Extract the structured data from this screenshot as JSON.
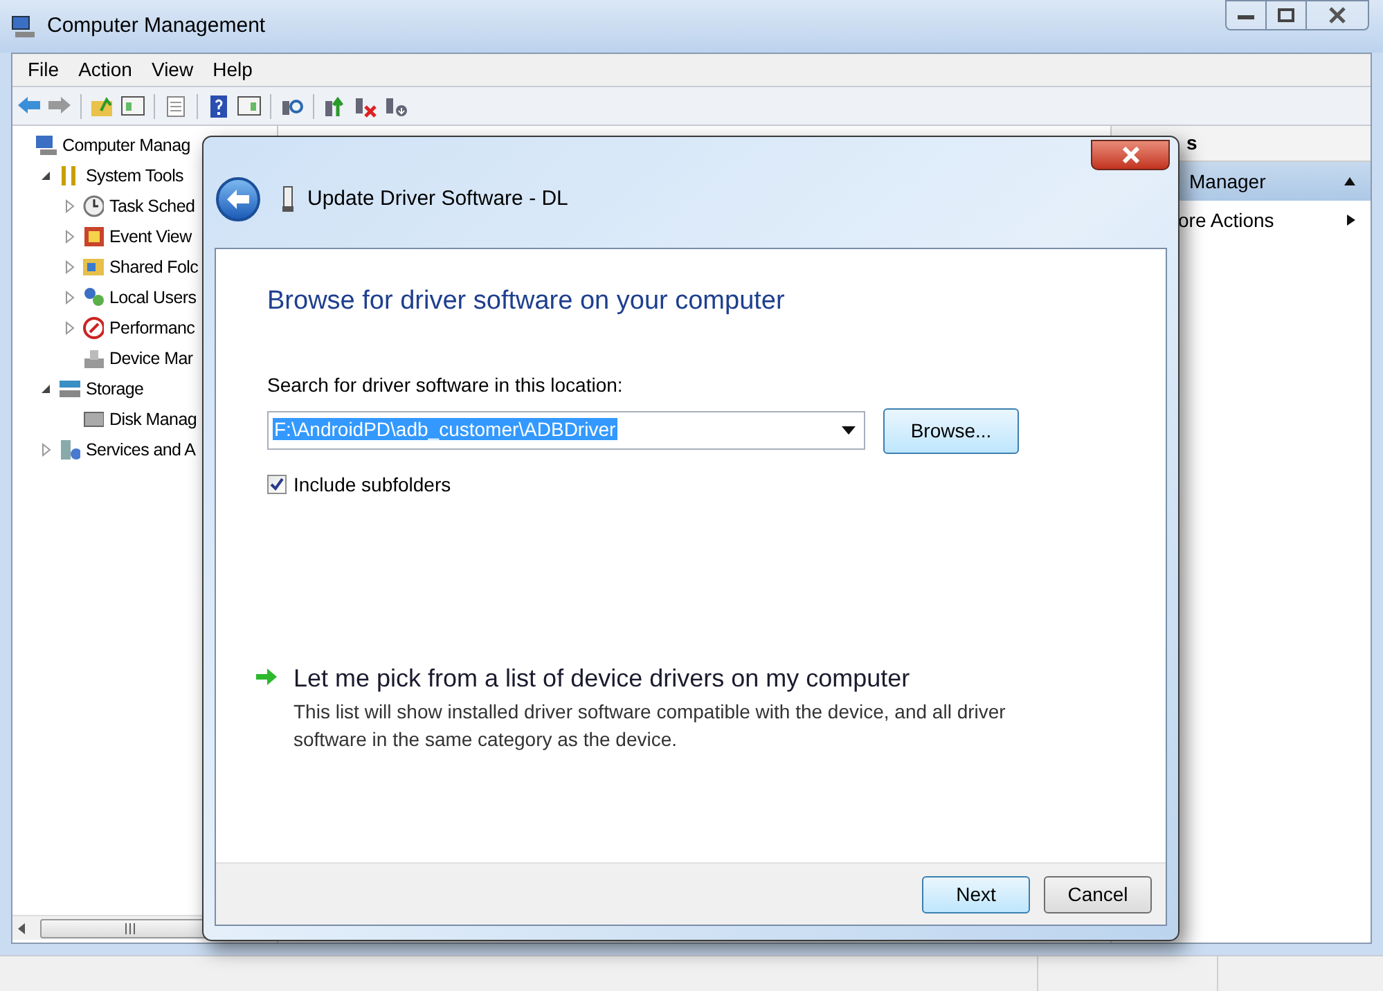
{
  "window": {
    "title": "Computer Management"
  },
  "menu": [
    {
      "label": "File"
    },
    {
      "label": "Action"
    },
    {
      "label": "View"
    },
    {
      "label": "Help"
    }
  ],
  "tree": [
    {
      "label": "Computer Manag",
      "children": [
        {
          "label": "System Tools",
          "expanded": true,
          "children": [
            {
              "label": "Task Sched",
              "expanded": false
            },
            {
              "label": "Event View",
              "expanded": false
            },
            {
              "label": "Shared Folc",
              "expanded": false
            },
            {
              "label": "Local Users",
              "expanded": false
            },
            {
              "label": "Performanc",
              "expanded": false
            },
            {
              "label": "Device Mar"
            }
          ]
        },
        {
          "label": "Storage",
          "expanded": true,
          "children": [
            {
              "label": "Disk Manag"
            }
          ]
        },
        {
          "label": "Services and A",
          "expanded": false
        }
      ]
    }
  ],
  "actions_pane": {
    "header": "s",
    "items": [
      {
        "label": "Manager",
        "kind": "section"
      },
      {
        "label": "ore Actions",
        "kind": "submenu"
      }
    ]
  },
  "dialog": {
    "title": "Update Driver Software - DL",
    "heading": "Browse for driver software on your computer",
    "location_label": "Search for driver software in this location:",
    "location_value": "F:\\AndroidPD\\adb_customer\\ADBDriver",
    "browse_button": "Browse...",
    "include_subfolders": {
      "label": "Include subfolders",
      "checked": true
    },
    "pick_link": {
      "title": "Let me pick from a list of device drivers on my computer",
      "description": "This list will show installed driver software compatible with the device, and all driver software in the same category as the device."
    },
    "buttons": [
      {
        "label": "Next",
        "default": true
      },
      {
        "label": "Cancel",
        "default": false
      }
    ]
  }
}
